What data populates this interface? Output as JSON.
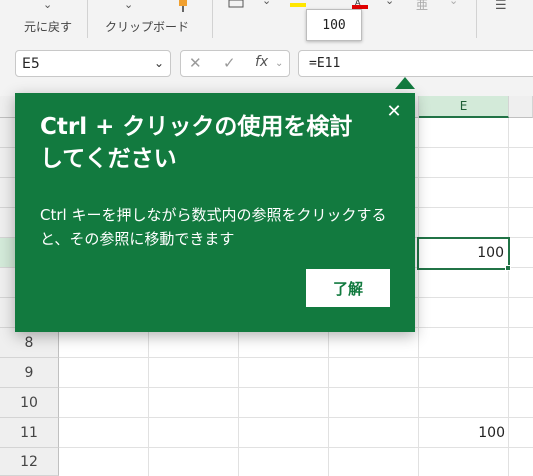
{
  "ribbon": {
    "undo_group_label": "元に戻す",
    "clipboard_group_label": "クリップボード"
  },
  "value_tooltip": "100",
  "formula_bar": {
    "name_box": "E5",
    "fx_label": "fx",
    "formula": "=E11"
  },
  "grid": {
    "columns": [
      "E"
    ],
    "row_numbers": [
      "8",
      "9",
      "10",
      "11",
      "12"
    ],
    "cells": {
      "E5": "100",
      "E11": "100"
    }
  },
  "callout": {
    "title": "Ctrl + クリックの使用を検討してください",
    "body": "Ctrl キーを押しながら数式内の参照をクリックすると、その参照に移動できます",
    "button_label": "了解",
    "close_icon": "close-icon"
  },
  "colors": {
    "accent": "#127a3f",
    "selection": "#217346"
  }
}
